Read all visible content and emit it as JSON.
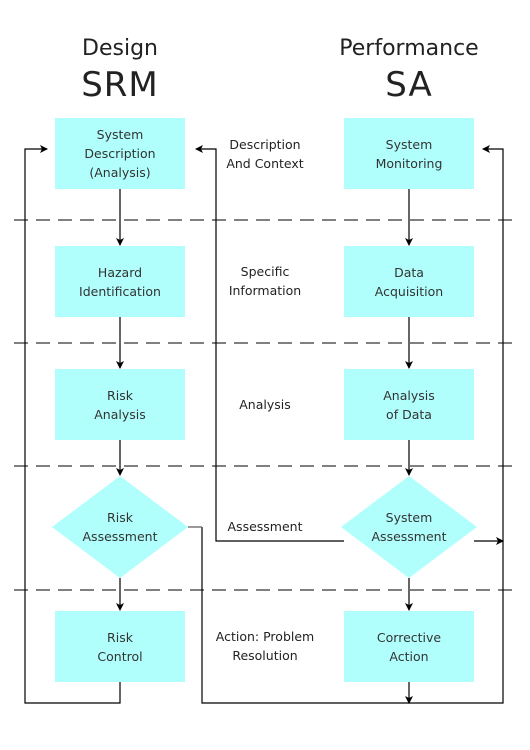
{
  "columns": {
    "left": {
      "subtitle": "Design",
      "title": "SRM"
    },
    "right": {
      "subtitle": "Performance",
      "title": "SA"
    }
  },
  "left_nodes": [
    {
      "text": "System\nDescription\n(Analysis)",
      "shape": "rect"
    },
    {
      "text": "Hazard\nIdentification",
      "shape": "rect"
    },
    {
      "text": "Risk\nAnalysis",
      "shape": "rect"
    },
    {
      "text": "Risk\nAssessment",
      "shape": "diamond"
    },
    {
      "text": "Risk\nControl",
      "shape": "rect"
    }
  ],
  "right_nodes": [
    {
      "text": "System\nMonitoring",
      "shape": "rect"
    },
    {
      "text": "Data\nAcquisition",
      "shape": "rect"
    },
    {
      "text": "Analysis\nof Data",
      "shape": "rect"
    },
    {
      "text": "System\nAssessment",
      "shape": "diamond"
    },
    {
      "text": "Corrective\nAction",
      "shape": "rect"
    }
  ],
  "stage_labels": [
    "Description\nAnd Context",
    "Specific\nInformation",
    "Analysis",
    "Assessment",
    "Action: Problem\nResolution"
  ],
  "colors": {
    "node_fill": "#b0fffc",
    "line": "#000000"
  }
}
